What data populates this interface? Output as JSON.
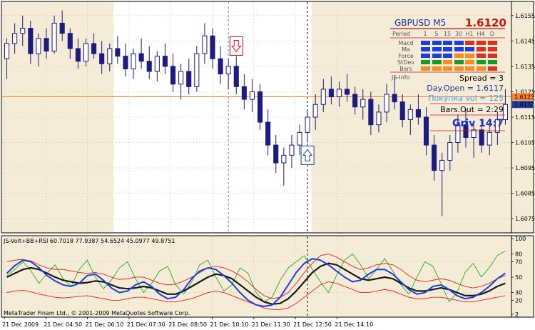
{
  "chart_data": [
    {
      "type": "candlestick",
      "symbol": "GBPUSD M5",
      "price_label": "1.6120",
      "ylim": [
        1.607,
        1.616
      ],
      "y_ticks": [
        "1.6155",
        "1.6145",
        "1.6135",
        "1.6125",
        "1.6115",
        "1.6105",
        "1.6095",
        "1.6085",
        "1.6075"
      ],
      "y_tick_values": [
        1.6155,
        1.6145,
        1.6135,
        1.6125,
        1.6115,
        1.6105,
        1.6095,
        1.6085,
        1.6075
      ],
      "price_tags": [
        {
          "label": "1.6123",
          "value": 1.6123,
          "color": "#ff7f27"
        },
        {
          "label": "1.6120",
          "value": 1.612,
          "color": "#1c3fa0"
        }
      ],
      "hline": {
        "value": 1.6123,
        "color": "#ff7f27"
      },
      "colors": {
        "up": "#1c1c80",
        "down": "#1c1c80",
        "bg": "#f5ecd7",
        "session_bg": "#ffffff",
        "axis_bg": "#f5ecd7"
      },
      "candles": [
        [
          1.6138,
          1.6146,
          1.613,
          1.6144
        ],
        [
          1.6144,
          1.6152,
          1.614,
          1.6148
        ],
        [
          1.6148,
          1.6155,
          1.6143,
          1.615
        ],
        [
          1.615,
          1.6153,
          1.6136,
          1.614
        ],
        [
          1.614,
          1.6148,
          1.6135,
          1.6146
        ],
        [
          1.6146,
          1.615,
          1.6138,
          1.6141
        ],
        [
          1.6141,
          1.6155,
          1.614,
          1.6152
        ],
        [
          1.6152,
          1.6157,
          1.6145,
          1.6148
        ],
        [
          1.6148,
          1.615,
          1.6138,
          1.6142
        ],
        [
          1.6142,
          1.6146,
          1.6134,
          1.6137
        ],
        [
          1.6137,
          1.6146,
          1.6135,
          1.6144
        ],
        [
          1.6144,
          1.6148,
          1.6138,
          1.614
        ],
        [
          1.614,
          1.6145,
          1.6132,
          1.6136
        ],
        [
          1.6136,
          1.6144,
          1.6133,
          1.6142
        ],
        [
          1.6142,
          1.6147,
          1.6136,
          1.6139
        ],
        [
          1.6139,
          1.6144,
          1.6131,
          1.6134
        ],
        [
          1.6134,
          1.6142,
          1.613,
          1.614
        ],
        [
          1.614,
          1.6146,
          1.6134,
          1.6137
        ],
        [
          1.6137,
          1.6143,
          1.613,
          1.6133
        ],
        [
          1.6133,
          1.6141,
          1.6129,
          1.6139
        ],
        [
          1.6139,
          1.6144,
          1.6132,
          1.6135
        ],
        [
          1.6135,
          1.614,
          1.6125,
          1.6128
        ],
        [
          1.6128,
          1.6136,
          1.6122,
          1.6133
        ],
        [
          1.6133,
          1.6138,
          1.6124,
          1.6127
        ],
        [
          1.6127,
          1.6143,
          1.6125,
          1.614
        ],
        [
          1.614,
          1.6152,
          1.6136,
          1.6147
        ],
        [
          1.6147,
          1.615,
          1.6134,
          1.6138
        ],
        [
          1.6138,
          1.6143,
          1.6128,
          1.6132
        ],
        [
          1.6132,
          1.6138,
          1.6126,
          1.6135
        ],
        [
          1.6135,
          1.6139,
          1.6124,
          1.6127
        ],
        [
          1.6127,
          1.6132,
          1.6118,
          1.6122
        ],
        [
          1.6122,
          1.613,
          1.6117,
          1.6125
        ],
        [
          1.6125,
          1.6128,
          1.611,
          1.6113
        ],
        [
          1.6113,
          1.6118,
          1.61,
          1.6104
        ],
        [
          1.6104,
          1.6108,
          1.6093,
          1.6097
        ],
        [
          1.6097,
          1.6103,
          1.6088,
          1.61
        ],
        [
          1.61,
          1.6108,
          1.6095,
          1.6104
        ],
        [
          1.6104,
          1.6112,
          1.61,
          1.6109
        ],
        [
          1.6109,
          1.6118,
          1.6105,
          1.6115
        ],
        [
          1.6115,
          1.6124,
          1.611,
          1.612
        ],
        [
          1.612,
          1.613,
          1.6117,
          1.6126
        ],
        [
          1.6126,
          1.6131,
          1.612,
          1.6123
        ],
        [
          1.6123,
          1.6129,
          1.6119,
          1.6126
        ],
        [
          1.6126,
          1.6132,
          1.6121,
          1.6124
        ],
        [
          1.6124,
          1.6127,
          1.6116,
          1.6119
        ],
        [
          1.6119,
          1.6126,
          1.6114,
          1.6122
        ],
        [
          1.6122,
          1.6125,
          1.6108,
          1.6112
        ],
        [
          1.6112,
          1.612,
          1.6109,
          1.6117
        ],
        [
          1.6117,
          1.6128,
          1.6113,
          1.6124
        ],
        [
          1.6124,
          1.6131,
          1.6118,
          1.6121
        ],
        [
          1.6121,
          1.6124,
          1.6111,
          1.6114
        ],
        [
          1.6114,
          1.612,
          1.6108,
          1.6118
        ],
        [
          1.6118,
          1.6124,
          1.6112,
          1.6115
        ],
        [
          1.6115,
          1.6119,
          1.61,
          1.6104
        ],
        [
          1.6104,
          1.6108,
          1.609,
          1.6094
        ],
        [
          1.6094,
          1.6101,
          1.6076,
          1.6098
        ],
        [
          1.6098,
          1.6108,
          1.6094,
          1.6105
        ],
        [
          1.6105,
          1.6116,
          1.6101,
          1.6112
        ],
        [
          1.6112,
          1.6118,
          1.6103,
          1.6107
        ],
        [
          1.6107,
          1.6113,
          1.6099,
          1.611
        ],
        [
          1.611,
          1.6114,
          1.6101,
          1.6104
        ],
        [
          1.6104,
          1.6112,
          1.61,
          1.6109
        ],
        [
          1.6109,
          1.6117,
          1.6104,
          1.6114
        ],
        [
          1.6114,
          1.6126,
          1.6112,
          1.612
        ]
      ],
      "x_ticks": [
        "21 Dec 2009",
        "21 Dec 04:50",
        "21 Dec 06:10",
        "21 Dec 07:30",
        "21 Dec 08:50",
        "21 Dec 10:10",
        "21 Dec 11:30",
        "21 Dec 12:50",
        "21 Dec 14:10"
      ],
      "session_band": {
        "start_index": 14,
        "end_index": 39
      },
      "vlines": [
        {
          "index": 28,
          "color": "#8a63c8"
        },
        {
          "index": 38,
          "color": "#000000"
        }
      ],
      "arrows": [
        {
          "index": 29,
          "direction": "down",
          "value": 1.6143,
          "color": "#d01010"
        },
        {
          "index": 38,
          "direction": "up",
          "value": 1.61,
          "color": "#1c3fa0"
        }
      ]
    },
    {
      "type": "line",
      "title": "JS-Volt+BB+RSI 60.7018 77.9387 54.6524 45.0977 49.8751",
      "ylim": [
        0,
        100
      ],
      "y_ticks": [
        "100",
        "80",
        "70",
        "50",
        "30",
        "20",
        "2"
      ],
      "y_tick_values": [
        100,
        80,
        70,
        50,
        30,
        20,
        2
      ],
      "series": [
        {
          "color": "#00aa00",
          "width": 0.8,
          "values": [
            52,
            60,
            70,
            58,
            42,
            55,
            66,
            48,
            38,
            60,
            72,
            50,
            35,
            46,
            62,
            70,
            48,
            30,
            42,
            58,
            64,
            40,
            28,
            44,
            66,
            72,
            50,
            32,
            40,
            62,
            55,
            30,
            18,
            24,
            46,
            62,
            70,
            78,
            60,
            44,
            30,
            52,
            72,
            80,
            66,
            48,
            60,
            74,
            58,
            40,
            28,
            50,
            70,
            64,
            42,
            18,
            30,
            56,
            68,
            50,
            62,
            78,
            84
          ]
        },
        {
          "color": "#ff0000",
          "width": 0.8,
          "values": [
            70,
            72,
            73,
            71,
            66,
            62,
            60,
            60,
            58,
            56,
            55,
            56,
            54,
            50,
            47,
            48,
            50,
            50,
            46,
            42,
            40,
            41,
            45,
            50,
            56,
            62,
            64,
            62,
            58,
            52,
            44,
            34,
            26,
            22,
            24,
            30,
            42,
            56,
            68,
            78,
            80,
            76,
            70,
            64,
            60,
            62,
            66,
            68,
            66,
            60,
            52,
            46,
            44,
            46,
            48,
            46,
            42,
            38,
            36,
            38,
            42,
            48,
            52
          ]
        },
        {
          "color": "#ff0000",
          "width": 0.8,
          "values": [
            30,
            32,
            33,
            31,
            28,
            26,
            24,
            23,
            24,
            25,
            26,
            24,
            22,
            20,
            20,
            22,
            24,
            24,
            22,
            20,
            18,
            18,
            20,
            22,
            26,
            30,
            32,
            30,
            26,
            22,
            18,
            14,
            10,
            8,
            8,
            10,
            16,
            24,
            32,
            40,
            44,
            42,
            38,
            34,
            30,
            30,
            32,
            34,
            32,
            28,
            24,
            22,
            22,
            24,
            24,
            22,
            20,
            18,
            18,
            20,
            22,
            24,
            26
          ]
        },
        {
          "color": "#1a1a1a",
          "width": 2.2,
          "values": [
            50,
            55,
            60,
            62,
            60,
            55,
            50,
            46,
            44,
            42,
            43,
            45,
            44,
            40,
            36,
            35,
            36,
            38,
            36,
            32,
            28,
            28,
            32,
            38,
            44,
            50,
            54,
            52,
            48,
            40,
            32,
            24,
            18,
            15,
            16,
            22,
            32,
            44,
            56,
            64,
            68,
            66,
            60,
            54,
            48,
            46,
            48,
            50,
            48,
            42,
            36,
            32,
            32,
            34,
            36,
            34,
            30,
            26,
            26,
            28,
            32,
            38,
            42
          ]
        },
        {
          "color": "#1a3ee0",
          "width": 2.0,
          "values": [
            55,
            65,
            72,
            70,
            62,
            52,
            45,
            40,
            38,
            42,
            52,
            54,
            46,
            36,
            30,
            32,
            40,
            44,
            38,
            28,
            22,
            24,
            34,
            48,
            58,
            62,
            60,
            52,
            42,
            30,
            20,
            14,
            12,
            14,
            24,
            40,
            56,
            68,
            74,
            72,
            66,
            58,
            50,
            44,
            46,
            54,
            60,
            60,
            54,
            44,
            34,
            28,
            30,
            38,
            40,
            34,
            26,
            22,
            24,
            30,
            38,
            48,
            55
          ]
        }
      ]
    }
  ],
  "footer": "MetaTrader Finam Ltd., © 2001-2009 MetaQuotes Software Corp.",
  "panel": {
    "symbol": "GBPUSD M5",
    "price": "1.6120",
    "period_label": "Period",
    "periods": [
      "1",
      "5",
      "15",
      "30",
      "H1",
      "H4",
      "D"
    ],
    "rows": [
      {
        "name": "Macd",
        "cells": [
          "#1a3ee0",
          "#1a3ee0",
          "#1a3ee0",
          "#1a3ee0",
          "#e0301e",
          "#e0301e",
          "#e0301e"
        ]
      },
      {
        "name": "Ma",
        "cells": [
          "#1a3ee0",
          "#1a3ee0",
          "#1a3ee0",
          "#1a3ee0",
          "#1a3ee0",
          "#e0301e",
          "#e0301e"
        ]
      },
      {
        "name": "Force",
        "cells": [
          "#1a3ee0",
          "#1a3ee0",
          "#1a3ee0",
          "#ff8c1a",
          "#ff8c1a",
          "#e0301e",
          "#e0301e"
        ]
      },
      {
        "name": "StDev",
        "cells": [
          "#1a9a2a",
          "#1a9a2a",
          "#ff8c1a",
          "#1a9a2a",
          "#ff8c1a",
          "#1a9a2a",
          "#1a9a2a"
        ]
      },
      {
        "name": "Bars",
        "cells": [
          "#ff8c1a",
          "#ff8c1a",
          "#ff8c1a",
          "#ff8c1a",
          "#ff8c1a",
          "#ff8c1a",
          "#e0301e"
        ]
      }
    ],
    "info_label": "JS-Info",
    "spread": "Spread = 3",
    "day_open": "Day.Open = 1.6117",
    "buy_vol": "Покупка vol = 125",
    "bars_out": "Bars.Out = 2:29",
    "griv": "Griv  14:7"
  }
}
